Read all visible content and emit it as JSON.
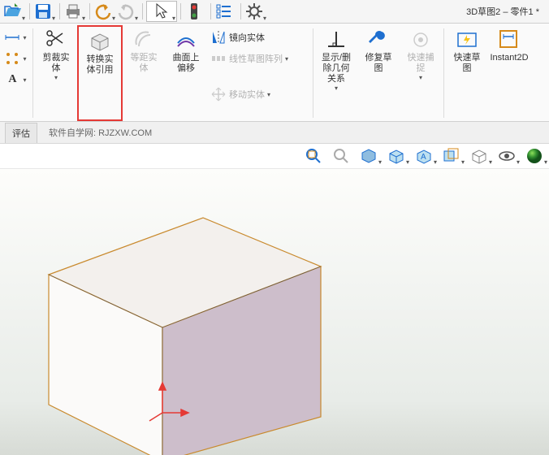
{
  "title": "3D草图2 – 零件1 *",
  "ribbon": {
    "trim": {
      "label": "剪裁实\n体"
    },
    "convert": {
      "label": "转换实\n体引用"
    },
    "offset_dist": {
      "label": "等距实\n体"
    },
    "surface_offset": {
      "label": "曲面上\n偏移"
    },
    "mirror": {
      "label": "镜向实体"
    },
    "linear_pattern": {
      "label": "线性草图阵列"
    },
    "move": {
      "label": "移动实体"
    },
    "display_rel": {
      "label": "显示/删\n除几何\n关系"
    },
    "repair": {
      "label": "修复草\n图"
    },
    "quick_snap": {
      "label": "快速捕\n捉"
    },
    "rapid_sketch": {
      "label": "快速草\n图"
    },
    "instant2d": {
      "label": "Instant2D"
    }
  },
  "statusbar": {
    "estimate": "评估",
    "watermark": "软件自学网: RJZXW.COM"
  },
  "colors": {
    "brand_green": "#2e8b2e",
    "blue": "#1e6fd0",
    "orange": "#d68a1a",
    "red_box": "#e53935",
    "cube_edge": "#c98a2e",
    "cube_side": "#cdbecb",
    "cube_top": "#f3f0ed"
  }
}
